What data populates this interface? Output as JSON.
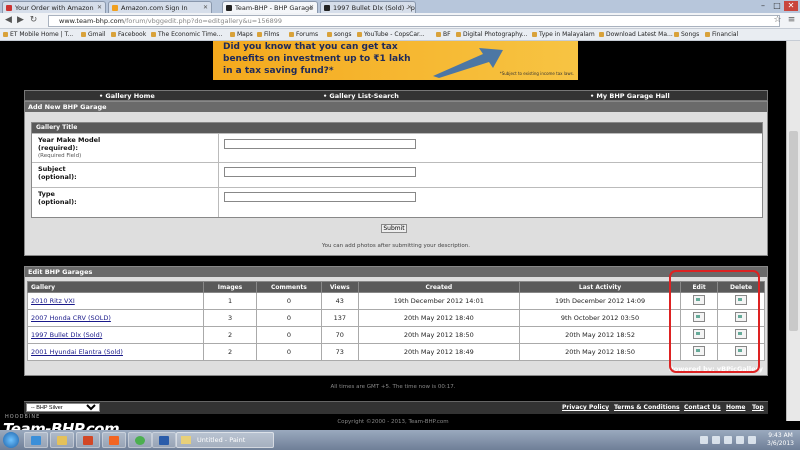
{
  "browser": {
    "tabs": [
      {
        "label": "Your Order with Amazon"
      },
      {
        "label": "Amazon.com Sign In"
      },
      {
        "label": "Team-BHP - BHP Garage"
      },
      {
        "label": "1997 Bullet Dlx (Sold) - pa"
      }
    ],
    "url_host": "www.team-bhp.com",
    "url_path": "/forum/vbggedit.php?do=editgallery&u=156899",
    "bookmarks": [
      "ET Mobile Home | T...",
      "Gmail",
      "Facebook",
      "The Economic Time...",
      "Maps",
      "Films",
      "Forums",
      "songs",
      "YouTube - CopsCar...",
      "BF",
      "Digital Photography...",
      "Type in Malayalam",
      "Download Latest Ma...",
      "Songs",
      "Financial"
    ]
  },
  "ad": {
    "line1": "Did you know that you can get tax",
    "line2": "benefits on investment up to ₹1 lakh",
    "line3": "in a tax saving fund?*",
    "note": "*Subject to existing income tax laws."
  },
  "topnav": {
    "gallery_home": "• Gallery Home",
    "gallery_list": "• Gallery List-Search",
    "my_garage": "• My BHP Garage Hall"
  },
  "add_form": {
    "title": "Add New BHP Garage",
    "box_title": "Gallery Title",
    "fields": [
      {
        "label": "Year Make Model",
        "sub": "(required):",
        "hint": "(Required Field)",
        "value": ""
      },
      {
        "label": "Subject",
        "sub": "(optional):",
        "hint": "",
        "value": ""
      },
      {
        "label": "Type",
        "sub": "(optional):",
        "hint": "",
        "value": ""
      }
    ],
    "submit": "Submit",
    "note": "You can add photos after submitting your description."
  },
  "garages": {
    "title": "Edit BHP Garages",
    "columns": [
      "Gallery",
      "Images",
      "Comments",
      "Views",
      "Created",
      "Last Activity",
      "Edit",
      "Delete"
    ],
    "rows": [
      {
        "gallery": "2010 Ritz VXI",
        "images": "1",
        "comments": "0",
        "views": "43",
        "created": "19th December 2012 14:01",
        "last": "19th December 2012 14:09"
      },
      {
        "gallery": "2007 Honda CRV (SOLD)",
        "images": "3",
        "comments": "0",
        "views": "137",
        "created": "20th May 2012 18:40",
        "last": "9th October 2012 03:50"
      },
      {
        "gallery": "1997 Bullet Dlx (Sold)",
        "images": "2",
        "comments": "0",
        "views": "70",
        "created": "20th May 2012 18:50",
        "last": "20th May 2012 18:52"
      },
      {
        "gallery": "2001 Hyundai Elantra (Sold)",
        "images": "2",
        "comments": "0",
        "views": "73",
        "created": "20th May 2012 18:49",
        "last": "20th May 2012 18:50"
      }
    ],
    "powered_by": "Powered by: vBPicGallery"
  },
  "footer": {
    "time_note": "All times are GMT +5. The time now is 00:17.",
    "style_select": "-- BHP Silver",
    "links": [
      "Privacy Policy",
      "Terms & Conditions",
      "Contact Us",
      "Home",
      "Top"
    ],
    "copyright": "Copyright ©2000 - 2013, Team-BHP.com",
    "logo": "Team-BHP.com",
    "logo_small": "HOODBINE"
  },
  "taskbar": {
    "paint_label": "Untitled - Paint",
    "time": "9:43 AM",
    "date": "3/6/2013"
  }
}
